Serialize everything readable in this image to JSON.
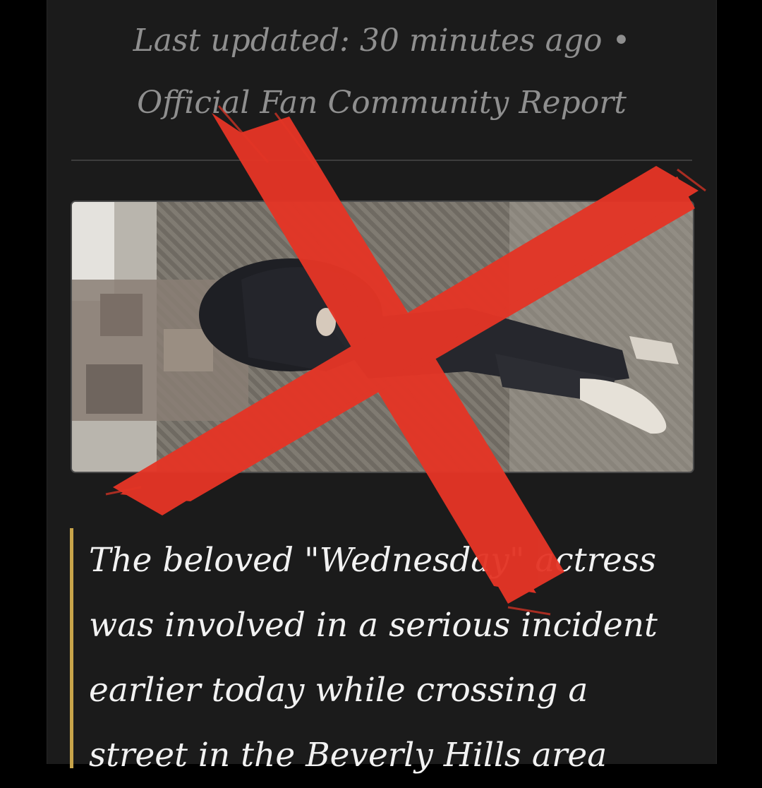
{
  "article": {
    "meta_line1": "Last updated: 30 minutes ago •",
    "meta_line2": "Official Fan Community Report",
    "photo": {
      "icon": "person-lying-on-floor-photo"
    },
    "quote": {
      "line1": "The beloved \"Wednesday\" actress",
      "line2": "was involved in a serious incident",
      "line3": "earlier today while crossing a",
      "line4": "street in the Beverly Hills area"
    }
  },
  "overlay": {
    "icon": "red-x-cross-mark",
    "color": "#e43526"
  },
  "colors": {
    "background": "#000000",
    "card": "#1b1b1b",
    "quote_bar": "#c8a44a",
    "meta_text": "#8f8f8f",
    "body_text": "#f2f2f2"
  }
}
